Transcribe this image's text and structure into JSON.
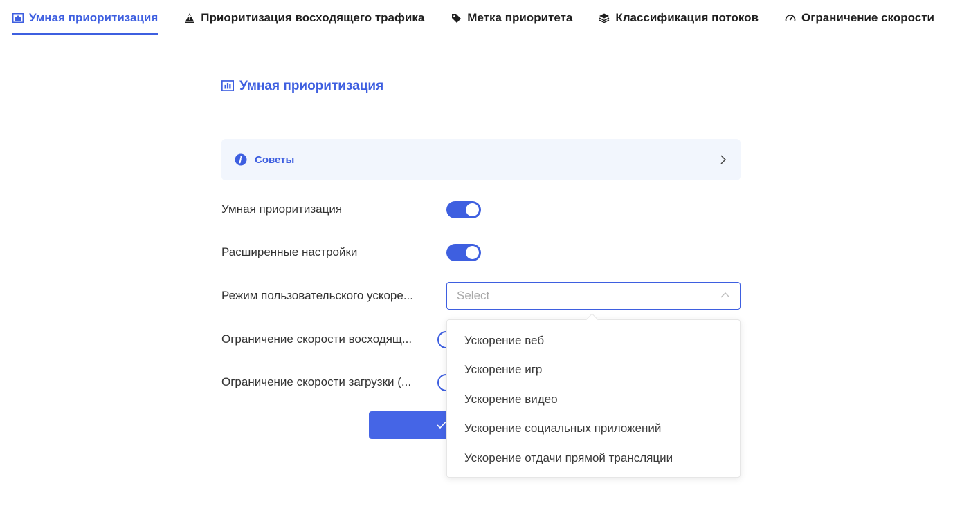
{
  "tabs": [
    {
      "label": "Умная приоритизация",
      "icon": "bar-chart-icon",
      "active": true
    },
    {
      "label": "Приоритизация восходящего трафика",
      "icon": "upload-priority-icon",
      "active": false
    },
    {
      "label": "Метка приоритета",
      "icon": "tag-icon",
      "active": false
    },
    {
      "label": "Классификация потоков",
      "icon": "layers-icon",
      "active": false
    },
    {
      "label": "Ограничение скорости",
      "icon": "speedometer-icon",
      "active": false
    }
  ],
  "section": {
    "title": "Умная приоритизация",
    "icon": "bar-chart-icon"
  },
  "tips": {
    "label": "Советы"
  },
  "settings": {
    "smart_priority": {
      "label": "Умная приоритизация",
      "enabled": true
    },
    "advanced": {
      "label": "Расширенные настройки",
      "enabled": true
    },
    "custom_mode": {
      "label": "Режим пользовательского ускоре...",
      "placeholder": "Select"
    },
    "upload_limit": {
      "label": "Ограничение скорости восходящ...",
      "enabled": false
    },
    "download_limit": {
      "label": "Ограничение скорости загрузки (...",
      "enabled": false
    }
  },
  "dropdown": {
    "options": [
      "Ускорение веб",
      "Ускорение игр",
      "Ускорение видео",
      "Ускорение социальных приложений",
      "Ускорение отдачи прямой трансляции"
    ]
  },
  "colors": {
    "accent": "#3e5fe0",
    "tips_bg": "#f2f6fd"
  }
}
